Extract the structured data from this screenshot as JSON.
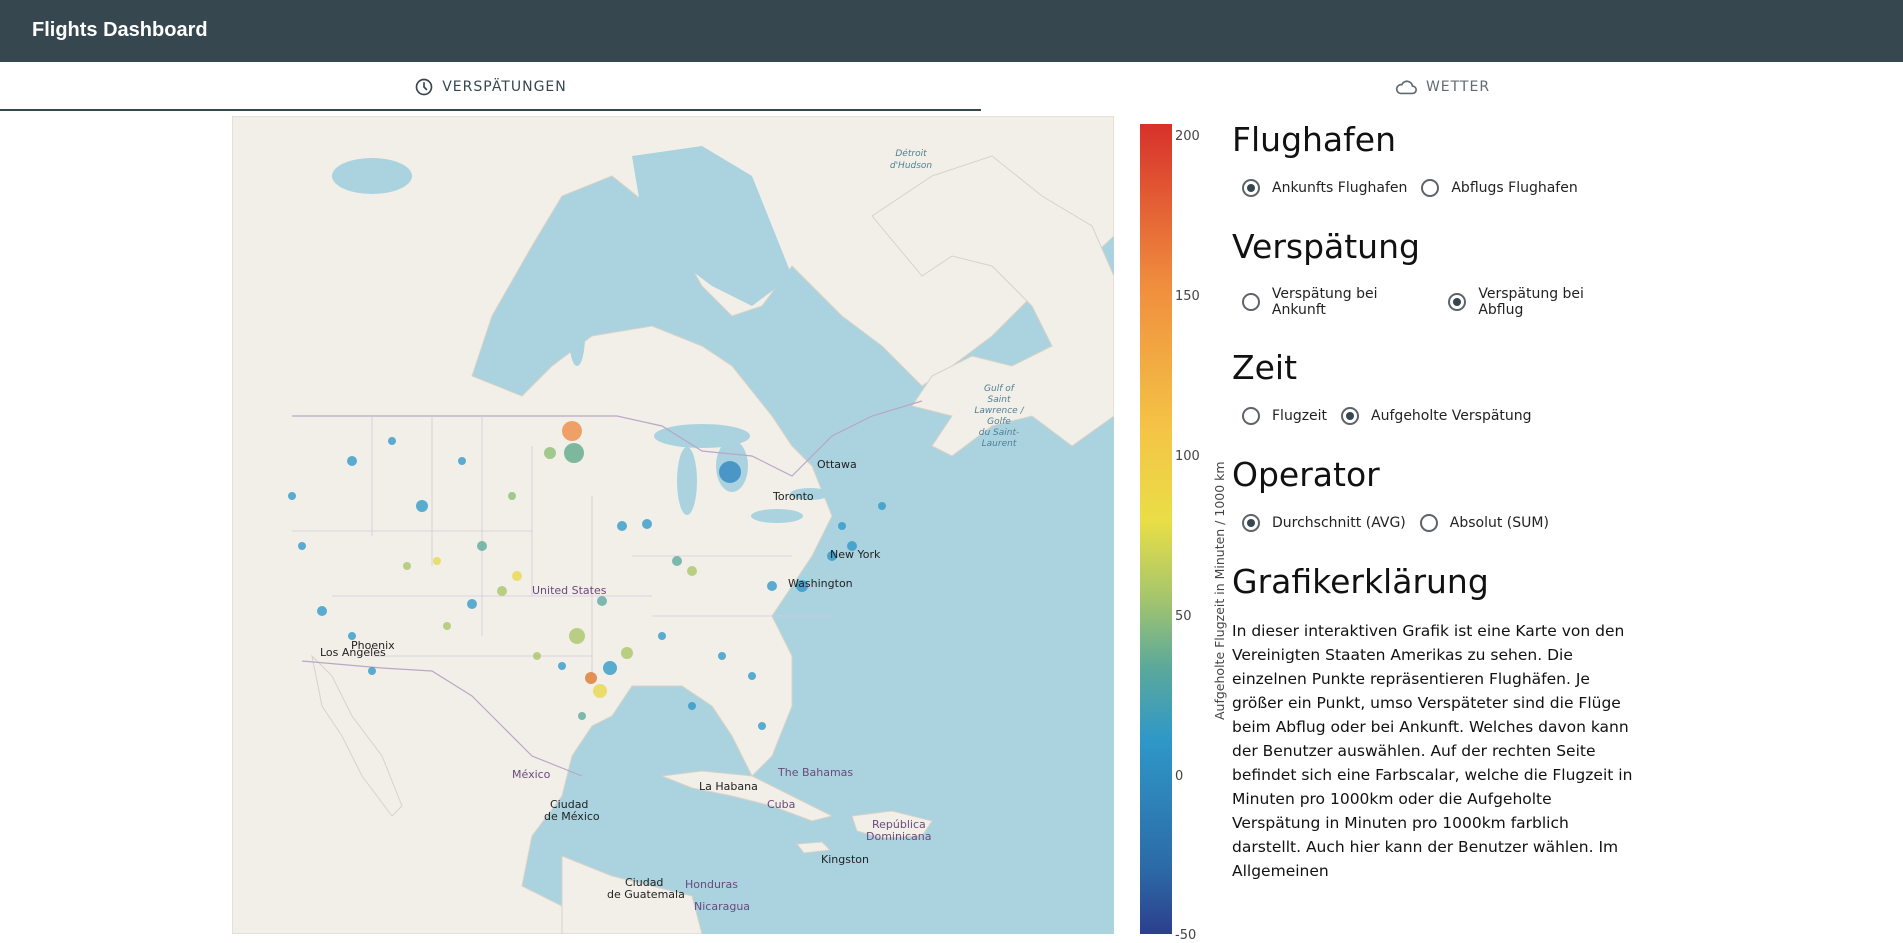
{
  "app": {
    "title": "Flights Dashboard"
  },
  "tabs": [
    {
      "label": "VERSPÄTUNGEN",
      "icon": "clock-icon",
      "active": true
    },
    {
      "label": "WETTER",
      "icon": "cloud-icon",
      "active": false
    }
  ],
  "map": {
    "labels": {
      "ottawa": "Ottawa",
      "toronto": "Toronto",
      "newyork": "New York",
      "washington": "Washington",
      "us": "United States",
      "phoenix": "Phoenix",
      "losangeles": "Los Angeles",
      "mexico": "México",
      "mexicocity1": "Ciudad",
      "mexicocity2": "de México",
      "bahamas": "The Bahamas",
      "habana": "La Habana",
      "cuba": "Cuba",
      "rd1": "República",
      "rd2": "Dominicana",
      "kingston": "Kingston",
      "guat1": "Ciudad",
      "guat2": "de Guatemala",
      "honduras": "Honduras",
      "nicaragua": "Nicaragua",
      "detroit1": "Détroit",
      "detroit2": "d'Hudson",
      "gulf1": "Gulf of",
      "gulf2": "Saint",
      "gulf3": "Lawrence /",
      "gulf4": "Golfe",
      "gulf5": "du Saint-",
      "gulf6": "Laurent"
    }
  },
  "colorbar": {
    "title": "Aufgeholte Flugzeit in Minuten / 1000 km",
    "ticks": [
      "200",
      "150",
      "100",
      "50",
      "0",
      "-50"
    ]
  },
  "sections": {
    "flughafen": {
      "title": "Flughafen",
      "options": [
        {
          "label": "Ankunfts Flughafen",
          "checked": true
        },
        {
          "label": "Abflugs Flughafen",
          "checked": false
        }
      ]
    },
    "verspaetung": {
      "title": "Verspätung",
      "options": [
        {
          "label": "Verspätung bei Ankunft",
          "checked": false
        },
        {
          "label": "Verspätung bei Abflug",
          "checked": true
        }
      ]
    },
    "zeit": {
      "title": "Zeit",
      "options": [
        {
          "label": "Flugzeit",
          "checked": false
        },
        {
          "label": "Aufgeholte Verspätung",
          "checked": true
        }
      ]
    },
    "operator": {
      "title": "Operator",
      "options": [
        {
          "label": "Durchschnitt (AVG)",
          "checked": true
        },
        {
          "label": "Absolut (SUM)",
          "checked": false
        }
      ]
    },
    "erklaerung": {
      "title": "Grafikerklärung",
      "text": "In dieser interaktiven Grafik ist eine Karte von den Vereinigten Staaten Amerikas zu sehen. Die einzelnen Punkte repräsentieren Flughäfen. Je größer ein Punkt, umso Verspäteter sind die Flüge beim Abflug oder bei Ankunft. Welches davon kann der Benutzer auswählen. Auf der rechten Seite befindet sich eine Farbscalar, welche die Flugzeit in Minuten pro 1000km oder die Aufgeholte Verspätung in Minuten pro 1000km farblich darstellt. Auch hier kann der Benutzer wählen. Im Allgemeinen"
    }
  },
  "colors": {
    "appbar": "#37474f",
    "water": "#aad3df",
    "land": "#f2efe9"
  }
}
